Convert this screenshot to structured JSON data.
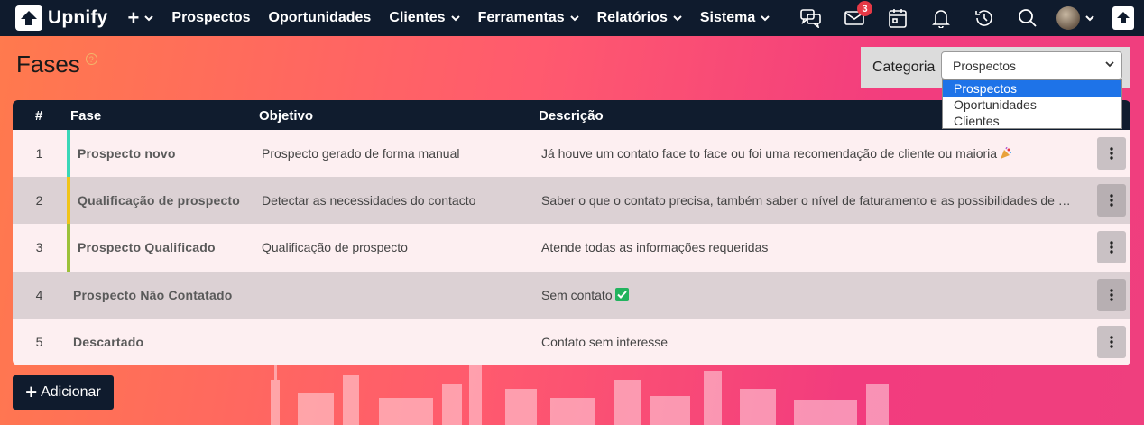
{
  "navbar": {
    "brand": "Upnify",
    "items": [
      {
        "label": "Prospectos",
        "has_dropdown": false
      },
      {
        "label": "Oportunidades",
        "has_dropdown": false
      },
      {
        "label": "Clientes",
        "has_dropdown": true
      },
      {
        "label": "Ferramentas",
        "has_dropdown": true
      },
      {
        "label": "Relatórios",
        "has_dropdown": true
      },
      {
        "label": "Sistema",
        "has_dropdown": true
      }
    ],
    "right_icons": [
      "chat-icon",
      "mail-icon",
      "calendar-icon",
      "bell-icon",
      "history-icon",
      "search-icon"
    ],
    "mail_badge": "3"
  },
  "page": {
    "title": "Fases",
    "help_icon": "question-icon"
  },
  "category": {
    "label": "Categoria",
    "selected": "Prospectos",
    "options": [
      "Prospectos",
      "Oportunidades",
      "Clientes"
    ]
  },
  "table": {
    "headers": {
      "num": "#",
      "fase": "Fase",
      "objetivo": "Objetivo",
      "descricao": "Descrição"
    },
    "rows": [
      {
        "num": "1",
        "fase": "Prospecto novo",
        "objetivo": "Prospecto gerado de forma manual",
        "descricao": "Já houve um contato face to face ou foi uma recomendação de cliente ou maioria",
        "accent": "#3ad7b8",
        "icon": "party-icon"
      },
      {
        "num": "2",
        "fase": "Qualificação de prospecto",
        "objetivo": "Detectar as necessidades do contacto",
        "descricao": "Saber o que o contato precisa, também saber o nível de faturamento e as possibilidades de negócio",
        "accent": "#f0c419",
        "icon": ""
      },
      {
        "num": "3",
        "fase": "Prospecto Qualificado",
        "objetivo": "Qualificação de prospecto",
        "descricao": "Atende todas as informações requeridas",
        "accent": "#9cc13a",
        "icon": ""
      },
      {
        "num": "4",
        "fase": "Prospecto Não Contatado",
        "objetivo": "",
        "descricao": "Sem contato",
        "accent": "",
        "icon": "check-icon"
      },
      {
        "num": "5",
        "fase": "Descartado",
        "objetivo": "",
        "descricao": "Contato sem interesse",
        "accent": "",
        "icon": ""
      }
    ]
  },
  "actions": {
    "add_label": "Adicionar"
  }
}
